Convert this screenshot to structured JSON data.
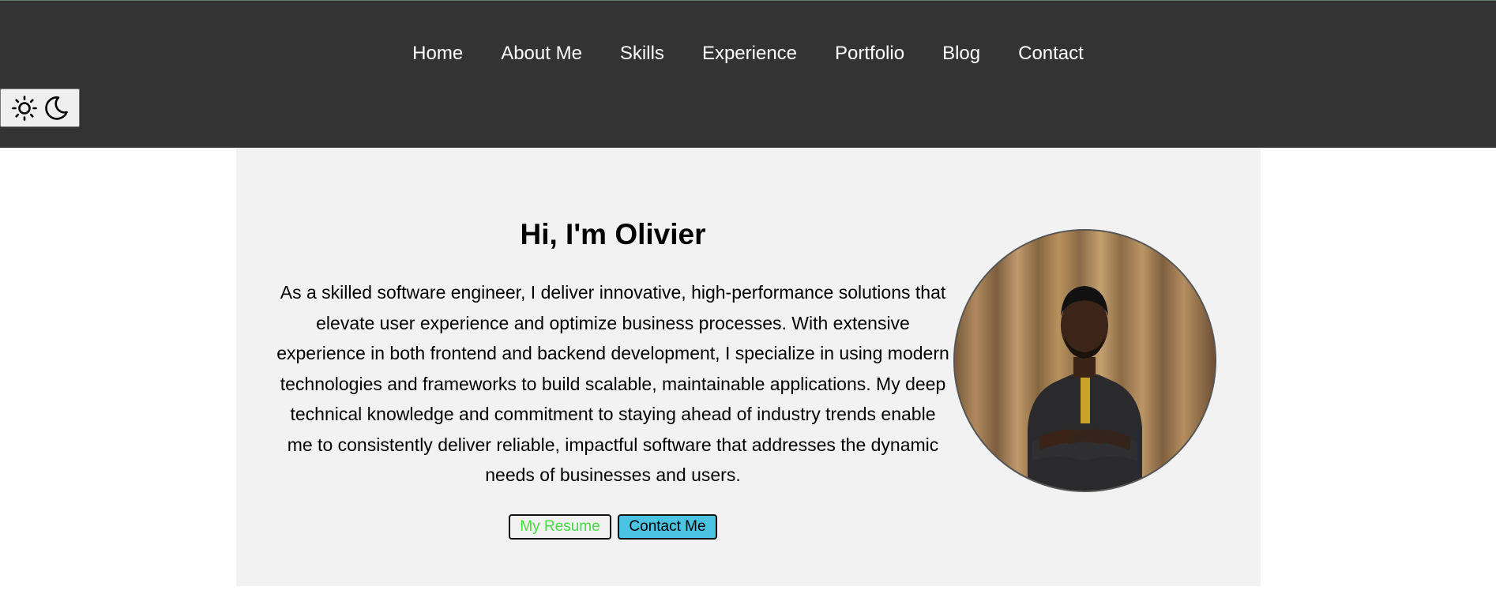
{
  "nav": {
    "items": [
      "Home",
      "About Me",
      "Skills",
      "Experience",
      "Portfolio",
      "Blog",
      "Contact"
    ]
  },
  "theme_toggle": {
    "icons": [
      "sun-icon",
      "moon-icon"
    ]
  },
  "hero": {
    "title": "Hi, I'm Olivier",
    "description": "As a skilled software engineer, I deliver innovative, high-performance solutions that elevate user experience and optimize business processes. With extensive experience in both frontend and backend development, I specialize in using modern technologies and frameworks to build scalable, maintainable applications. My deep technical knowledge and commitment to staying ahead of industry trends enable me to consistently deliver reliable, impactful software that addresses the dynamic needs of businesses and users.",
    "resume_button": "My Resume",
    "contact_button": "Contact Me"
  },
  "colors": {
    "header_bg": "#333333",
    "hero_bg": "#f2f2f2",
    "resume_text": "#44dd44",
    "contact_bg": "#4cc3e3"
  }
}
